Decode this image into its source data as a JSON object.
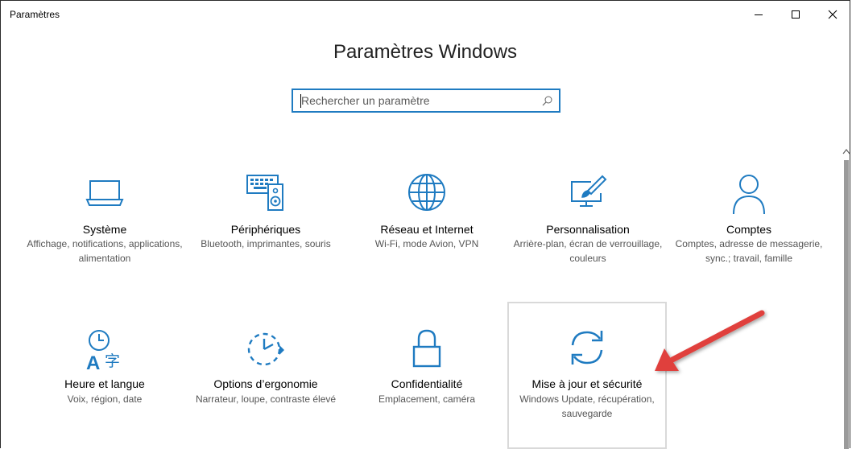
{
  "window": {
    "title": "Paramètres"
  },
  "header": {
    "title": "Paramètres Windows"
  },
  "search": {
    "placeholder": "Rechercher un paramètre"
  },
  "tiles": [
    {
      "label": "Système",
      "desc": "Affichage, notifications, applications, alimentation",
      "icon": "laptop-icon"
    },
    {
      "label": "Périphériques",
      "desc": "Bluetooth, imprimantes, souris",
      "icon": "devices-icon"
    },
    {
      "label": "Réseau et Internet",
      "desc": "Wi-Fi, mode Avion, VPN",
      "icon": "globe-icon"
    },
    {
      "label": "Personnalisation",
      "desc": "Arrière-plan, écran de verrouillage, couleurs",
      "icon": "personalization-icon"
    },
    {
      "label": "Comptes",
      "desc": "Comptes, adresse de messagerie, sync.; travail, famille",
      "icon": "person-icon"
    },
    {
      "label": "Heure et langue",
      "desc": "Voix, région, date",
      "icon": "time-language-icon"
    },
    {
      "label": "Options d’ergonomie",
      "desc": "Narrateur, loupe, contraste élevé",
      "icon": "ease-of-access-icon"
    },
    {
      "label": "Confidentialité",
      "desc": "Emplacement, caméra",
      "icon": "lock-icon"
    },
    {
      "label": "Mise à jour et sécurité",
      "desc": "Windows Update, récupération, sauvegarde",
      "icon": "update-sync-icon"
    }
  ],
  "colors": {
    "accent": "#1f7bc1",
    "annotation_arrow": "#e0413c"
  }
}
